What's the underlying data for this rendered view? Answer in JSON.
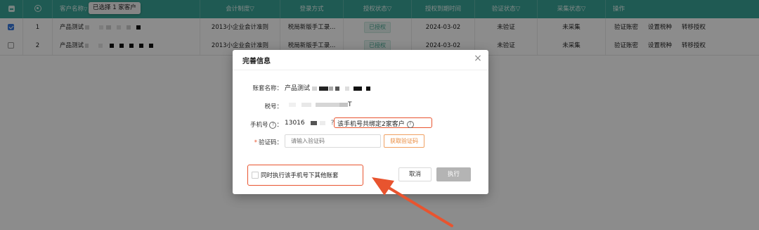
{
  "table": {
    "headers": {
      "customer_name": "客户名称",
      "accounting_system": "会计制度▽",
      "login_method": "登录方式",
      "auth_status": "授权状态▽",
      "auth_expiry": "授权到期时间",
      "verify_status": "验证状态▽",
      "collect_status": "采集状态▽",
      "actions": "操作"
    },
    "selection_tooltip": "已选择 1 家客户",
    "rows": [
      {
        "index": "1",
        "name": "产品测试",
        "accounting_system": "2013小企业会计准则",
        "login_method": "税局新版手工录...",
        "auth_status": "已授权",
        "auth_expiry": "2024-03-02",
        "verify_status": "未验证",
        "collect_status": "未采集",
        "actions": [
          "验证账密",
          "设置税种",
          "转移授权"
        ],
        "checked": true
      },
      {
        "index": "2",
        "name": "产品测试",
        "accounting_system": "2013小企业会计准则",
        "login_method": "税局新版手工录...",
        "auth_status": "已授权",
        "auth_expiry": "2024-03-02",
        "verify_status": "未验证",
        "collect_status": "未采集",
        "actions": [
          "验证账密",
          "设置税种",
          "转移授权"
        ],
        "checked": false
      }
    ]
  },
  "modal": {
    "title": "完善信息",
    "close_symbol": "×",
    "account_label": "账套名称：",
    "account_value": "产品测试",
    "tax_label": "税号：",
    "tax_value_suffix": "T",
    "phone_label": "手机号",
    "phone_value": "13016",
    "bound_notice": "该手机号共绑定2家客户",
    "code_label": "验证码：",
    "code_required": "*",
    "code_placeholder": "请输入验证码",
    "get_code_button": "获取验证码",
    "apply_all_label": "同时执行该手机号下其他账套",
    "cancel_button": "取消",
    "execute_button": "执行"
  },
  "colors": {
    "header_teal": "#3aa597",
    "highlight_red": "#e8542f",
    "get_code_orange": "#e98a3c",
    "execute_disabled": "#b4b4b4"
  }
}
